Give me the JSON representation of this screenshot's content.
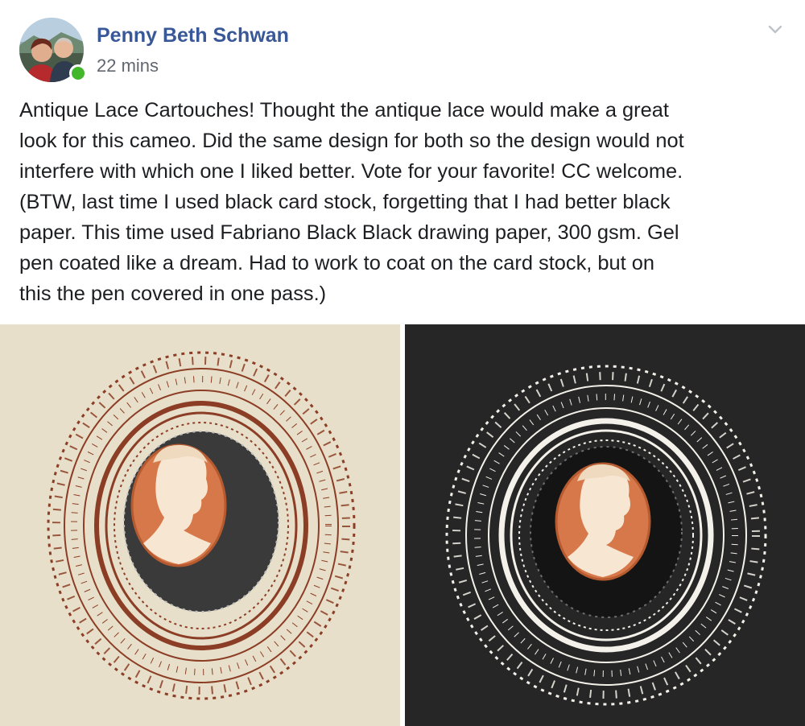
{
  "post": {
    "author": {
      "name": "Penny Beth Schwan",
      "online": true,
      "presence_color": "#42b72a"
    },
    "timestamp": "22 mins",
    "menu_icon": "chevron-down-icon",
    "text": "Antique Lace Cartouches! Thought the antique lace would make a great\nlook for this cameo. Did the same design for both so the design would not\ninterfere with which one I liked better. Vote for your favorite! CC welcome.\n(BTW, last time I used black card stock, forgetting that I had better black\npaper. This time used Fabriano Black Black drawing paper, 300 gsm. Gel\npen coated like a dream. Had to work to coat on the card stock, but on\nthis the pen covered in one pass.)"
  },
  "photos": [
    {
      "id": "cream-paper-lace-cameo",
      "paper_color": "#e8dfca",
      "lace_color": "#8b3e25"
    },
    {
      "id": "black-paper-lace-cameo",
      "paper_color": "#262626",
      "lace_color": "#f4f1ea"
    }
  ],
  "colors": {
    "name_link": "#385898",
    "meta_text": "#616770",
    "body_text": "#1c1e21",
    "cameo_shell": "#d7784a",
    "cameo_figure": "#f6e6d2"
  }
}
